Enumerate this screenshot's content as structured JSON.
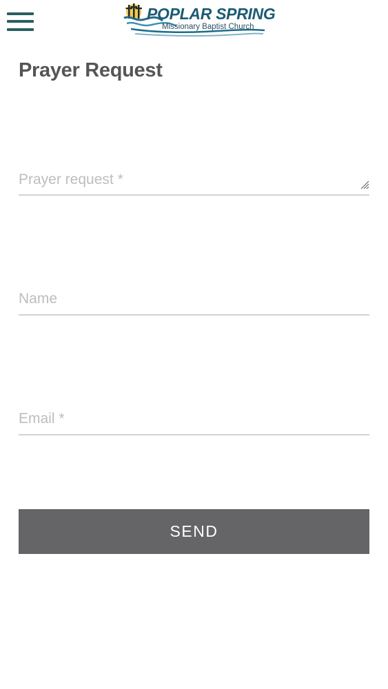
{
  "header": {
    "menu_icon": "hamburger-menu-icon",
    "logo": {
      "title": "POPLAR SPRING",
      "subtitle": "Missionary Baptist Church",
      "colors": {
        "title": "#1d5b73",
        "wave": "#1f6b8a",
        "sun": "#f2c94c",
        "cross": "#1f2a2a"
      }
    }
  },
  "main": {
    "title": "Prayer Request",
    "form": {
      "prayer_request": {
        "placeholder": "Prayer request *",
        "value": ""
      },
      "name": {
        "placeholder": "Name",
        "value": ""
      },
      "email": {
        "placeholder": "Email *",
        "value": ""
      },
      "send_label": "SEND"
    }
  },
  "colors": {
    "accent": "#2a5f5f",
    "heading": "#555555",
    "placeholder": "#bdbdbd",
    "underline": "#d2d2d2",
    "button": "#656567",
    "button_text": "#ffffff"
  }
}
